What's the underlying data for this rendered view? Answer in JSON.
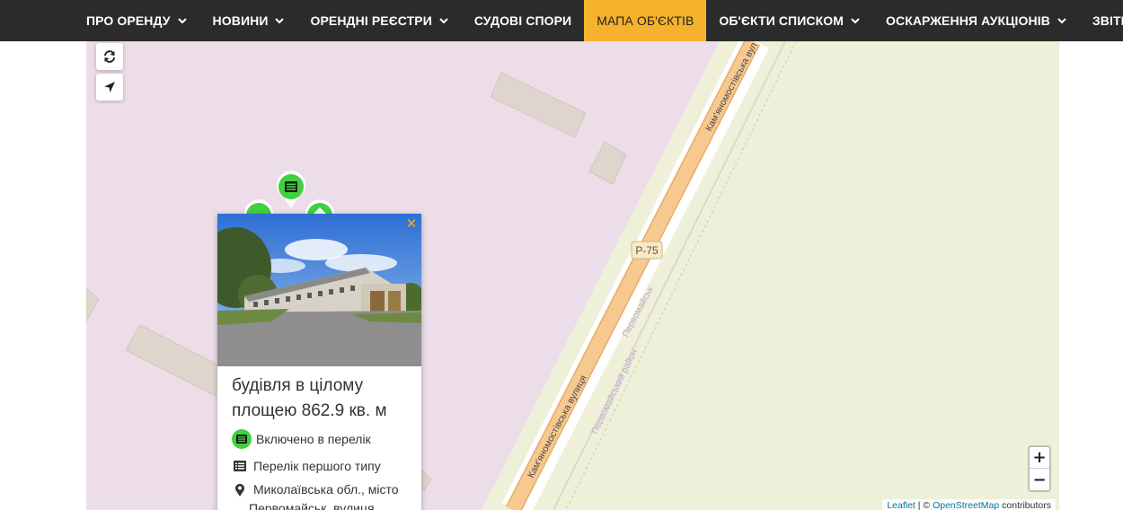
{
  "nav": {
    "items": [
      {
        "label": "ПРО ОРЕНДУ",
        "dropdown": true,
        "active": false
      },
      {
        "label": "НОВИНИ",
        "dropdown": true,
        "active": false
      },
      {
        "label": "ОРЕНДНІ РЕЄСТРИ",
        "dropdown": true,
        "active": false
      },
      {
        "label": "СУДОВІ СПОРИ",
        "dropdown": false,
        "active": false
      },
      {
        "label": "МАПА ОБ'ЄКТІВ",
        "dropdown": false,
        "active": true
      },
      {
        "label": "ОБ'ЄКТИ СПИСКОМ",
        "dropdown": true,
        "active": false
      },
      {
        "label": "ОСКАРЖЕННЯ АУКЦІОНІВ",
        "dropdown": true,
        "active": false
      },
      {
        "label": "ЗВІТНІСТЬ",
        "dropdown": true,
        "active": false
      }
    ],
    "active_color": "#f5b22c"
  },
  "map": {
    "controls": {
      "refresh_icon": "refresh-icon",
      "locate_icon": "location-arrow-icon"
    },
    "zoom": {
      "in_label": "+",
      "out_label": "−"
    },
    "attribution": {
      "leaflet": "Leaflet",
      "separator": " | © ",
      "osm": "OpenStreetMap",
      "suffix": " contributors"
    },
    "labels": {
      "road_shield": "Р-75",
      "street_upper": "Кам'яномостівська вул",
      "street_lower": "Кам'яномостівська вулиця",
      "locality": "Первомайськ",
      "district": "Первомайський район"
    },
    "colors": {
      "industrial": "#ecdde9",
      "land": "#eff0da",
      "road": "#f7c98f",
      "building": "#dfd5cc",
      "marker_green": "#3fd13f"
    }
  },
  "popup": {
    "close_icon": "close-icon",
    "title_line1": "будівля в цілому",
    "title_line2": "площею 862.9 кв. м",
    "status": "Включено в перелік",
    "list_type": "Перелік першого типу",
    "address_line1": "Миколаївська обл., місто",
    "address_line2": "Первомайськ, вулиця"
  }
}
